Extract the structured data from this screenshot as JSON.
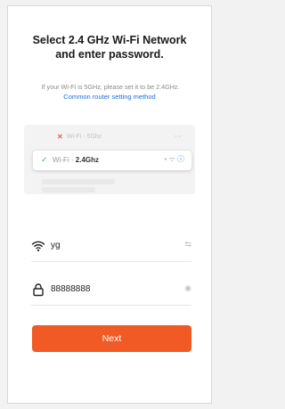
{
  "title_line1": "Select 2.4 GHz Wi-Fi Network",
  "title_line2": "and enter password.",
  "hint": "If your Wi-Fi is 5GHz, please set it to be 2.4GHz.",
  "link": "Common router setting method",
  "illustration": {
    "network_5g": "Wi-Fi - 5Ghz",
    "network_24_prefix": "Wi-Fi - ",
    "network_24_band": "2.4Ghz"
  },
  "wifi": {
    "ssid": "yg",
    "icon": "wifi-icon",
    "switch_icon": "swap-icon"
  },
  "password": {
    "value": "88888888",
    "icon": "lock-icon",
    "toggle_icon": "eye-icon"
  },
  "next_label": "Next",
  "colors": {
    "accent": "#f15a24",
    "link": "#1e6fd9",
    "check": "#4caf50",
    "error": "#e85a5a"
  }
}
